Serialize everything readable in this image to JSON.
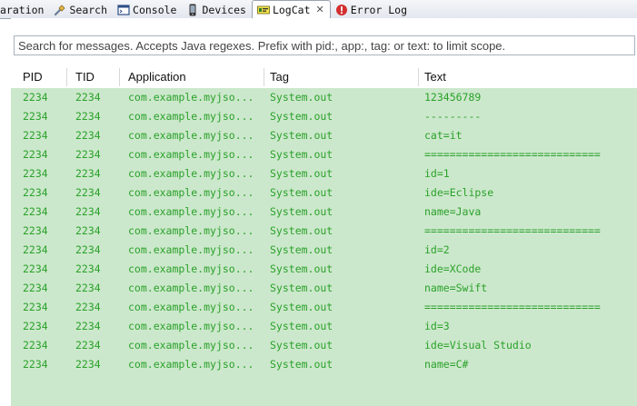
{
  "tabs": [
    {
      "label": "aration",
      "icon": "window-icon"
    },
    {
      "label": "Search",
      "icon": "flashlight-search-icon"
    },
    {
      "label": "Console",
      "icon": "console-icon"
    },
    {
      "label": "Devices",
      "icon": "phone-icon"
    },
    {
      "label": "LogCat",
      "icon": "logcat-icon",
      "active": true,
      "close": "✕"
    },
    {
      "label": "Error Log",
      "icon": "error-log-icon"
    }
  ],
  "search": {
    "placeholder": "Search for messages. Accepts Java regexes. Prefix with pid:, app:, tag: or text: to limit scope."
  },
  "columns": {
    "pid": "PID",
    "tid": "TID",
    "app": "Application",
    "tag": "Tag",
    "text": "Text"
  },
  "rows": [
    {
      "pid": "2234",
      "tid": "2234",
      "app": "com.example.myjso...",
      "tag": "System.out",
      "text": "123456789"
    },
    {
      "pid": "2234",
      "tid": "2234",
      "app": "com.example.myjso...",
      "tag": "System.out",
      "text": "---------"
    },
    {
      "pid": "2234",
      "tid": "2234",
      "app": "com.example.myjso...",
      "tag": "System.out",
      "text": "cat=it"
    },
    {
      "pid": "2234",
      "tid": "2234",
      "app": "com.example.myjso...",
      "tag": "System.out",
      "text": "============================"
    },
    {
      "pid": "2234",
      "tid": "2234",
      "app": "com.example.myjso...",
      "tag": "System.out",
      "text": "id=1"
    },
    {
      "pid": "2234",
      "tid": "2234",
      "app": "com.example.myjso...",
      "tag": "System.out",
      "text": "ide=Eclipse"
    },
    {
      "pid": "2234",
      "tid": "2234",
      "app": "com.example.myjso...",
      "tag": "System.out",
      "text": "name=Java"
    },
    {
      "pid": "2234",
      "tid": "2234",
      "app": "com.example.myjso...",
      "tag": "System.out",
      "text": "============================"
    },
    {
      "pid": "2234",
      "tid": "2234",
      "app": "com.example.myjso...",
      "tag": "System.out",
      "text": "id=2"
    },
    {
      "pid": "2234",
      "tid": "2234",
      "app": "com.example.myjso...",
      "tag": "System.out",
      "text": "ide=XCode"
    },
    {
      "pid": "2234",
      "tid": "2234",
      "app": "com.example.myjso...",
      "tag": "System.out",
      "text": "name=Swift"
    },
    {
      "pid": "2234",
      "tid": "2234",
      "app": "com.example.myjso...",
      "tag": "System.out",
      "text": "============================"
    },
    {
      "pid": "2234",
      "tid": "2234",
      "app": "com.example.myjso...",
      "tag": "System.out",
      "text": "id=3"
    },
    {
      "pid": "2234",
      "tid": "2234",
      "app": "com.example.myjso...",
      "tag": "System.out",
      "text": "ide=Visual Studio"
    },
    {
      "pid": "2234",
      "tid": "2234",
      "app": "com.example.myjso...",
      "tag": "System.out",
      "text": "name=C#"
    }
  ],
  "colors": {
    "row_background": "#cce8cc",
    "log_text": "#2aa12a"
  }
}
